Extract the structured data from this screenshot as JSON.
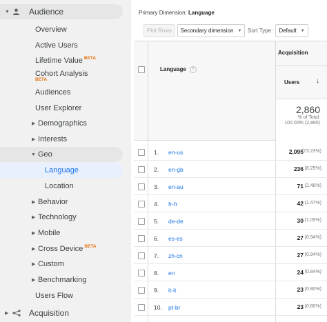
{
  "sidebar": {
    "audience": "Audience",
    "overview": "Overview",
    "active_users": "Active Users",
    "lifetime_value": "Lifetime Value",
    "cohort_analysis": "Cohort Analysis",
    "audiences": "Audiences",
    "user_explorer": "User Explorer",
    "demographics": "Demographics",
    "interests": "Interests",
    "geo": "Geo",
    "language": "Language",
    "location": "Location",
    "behavior": "Behavior",
    "technology": "Technology",
    "mobile": "Mobile",
    "cross_device": "Cross Device",
    "custom": "Custom",
    "benchmarking": "Benchmarking",
    "users_flow": "Users Flow",
    "acquisition": "Acquisition",
    "beta": "BETA"
  },
  "toolbar": {
    "primary_dimension_label": "Primary Dimension:",
    "primary_dimension_value": "Language",
    "plot_rows": "Plot Rows",
    "secondary_dimension": "Secondary dimension",
    "sort_type_label": "Sort Type:",
    "sort_type_value": "Default"
  },
  "table": {
    "col_language": "Language",
    "group_acquisition": "Acquisition",
    "col_users": "Users",
    "total_value": "2,860",
    "total_line1": "% of Total:",
    "total_line2": "100.00% (2,860)",
    "rows": [
      {
        "idx": "1.",
        "lang": "en-us",
        "users": "2,095",
        "pct": "(73.23%)"
      },
      {
        "idx": "2.",
        "lang": "en-gb",
        "users": "236",
        "pct": "(8.25%)"
      },
      {
        "idx": "3.",
        "lang": "en-au",
        "users": "71",
        "pct": "(2.48%)"
      },
      {
        "idx": "4.",
        "lang": "fr-fr",
        "users": "42",
        "pct": "(1.47%)"
      },
      {
        "idx": "5.",
        "lang": "de-de",
        "users": "30",
        "pct": "(1.05%)"
      },
      {
        "idx": "6.",
        "lang": "es-es",
        "users": "27",
        "pct": "(0.94%)"
      },
      {
        "idx": "7.",
        "lang": "zh-cn",
        "users": "27",
        "pct": "(0.94%)"
      },
      {
        "idx": "8.",
        "lang": "en",
        "users": "24",
        "pct": "(0.84%)"
      },
      {
        "idx": "9.",
        "lang": "it-it",
        "users": "23",
        "pct": "(0.80%)"
      },
      {
        "idx": "10.",
        "lang": "pt-br",
        "users": "23",
        "pct": "(0.80%)"
      }
    ]
  },
  "colors": {
    "accent": "#1a73e8",
    "beta": "#e8710a",
    "sidebar_bg": "#f1f1f1",
    "active_bg": "#e8f0fe"
  }
}
